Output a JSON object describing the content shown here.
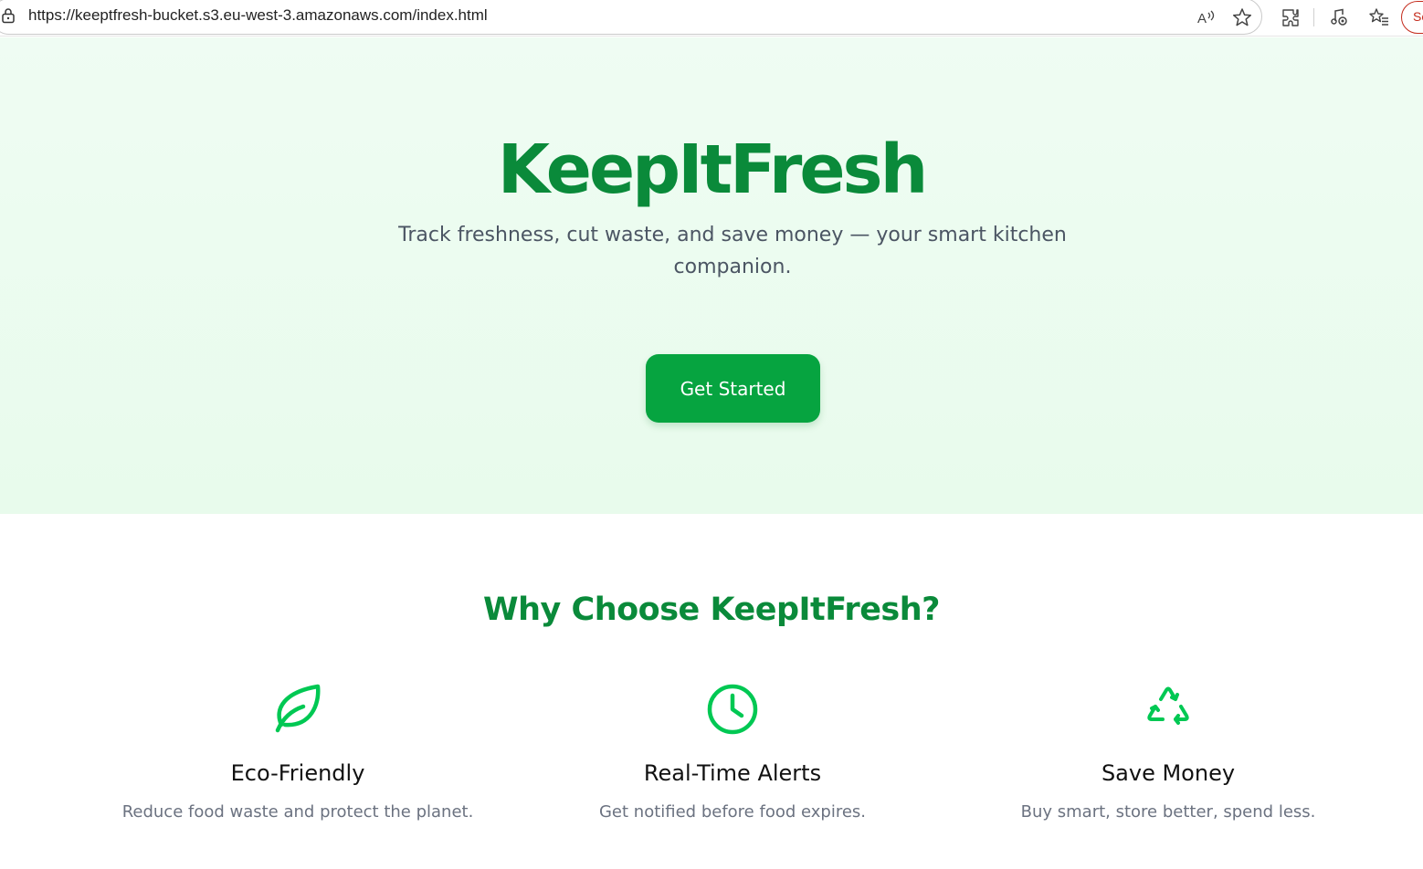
{
  "browser": {
    "url": "https://keeptfresh-bucket.s3.eu-west-3.amazonaws.com/index.html",
    "profile_label": "Se",
    "icons": [
      "lock-icon",
      "read-aloud-icon",
      "favorite-star-icon",
      "extensions-icon",
      "media-icon",
      "favorites-list-icon"
    ]
  },
  "hero": {
    "title": "KeepItFresh",
    "subtitle": "Track freshness, cut waste, and save money — your smart kitchen companion.",
    "cta_label": "Get Started"
  },
  "features": {
    "heading": "Why Choose KeepItFresh?",
    "items": [
      {
        "icon": "leaf-icon",
        "title": "Eco-Friendly",
        "description": "Reduce food waste and protect the planet."
      },
      {
        "icon": "clock-icon",
        "title": "Real-Time Alerts",
        "description": "Get notified before food expires."
      },
      {
        "icon": "recycle-icon",
        "title": "Save Money",
        "description": "Buy smart, store better, spend less."
      }
    ]
  },
  "colors": {
    "brand_green": "#0a8a3a",
    "button_green": "#06a440",
    "icon_green": "#00c853",
    "hero_background": "#eafbee",
    "body_text": "#4b5563"
  }
}
